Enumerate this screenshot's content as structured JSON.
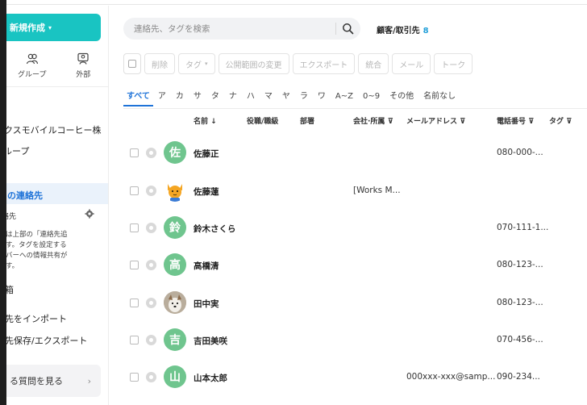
{
  "sidebar": {
    "new_button": "新規作成",
    "tabs": [
      {
        "label": "グループ",
        "icon": "group-icon"
      },
      {
        "label": "外部",
        "icon": "external-icon"
      }
    ],
    "items": {
      "item1": "ークスモバイルコーヒー株",
      "item2": "ループ",
      "all_contacts": "この連絡先",
      "sub_label": "絡先",
      "note": "追加は上部の「連絡先追\nえます。タグを設定する\nメンバーへの情報共有が\nえます。",
      "trash": "箱",
      "import": "先をインポート",
      "export": "先保存/エクスポート",
      "faq": "る質問を見る"
    }
  },
  "search": {
    "placeholder": "連絡先、タグを検索"
  },
  "breadcrumb": {
    "label": "顧客/取引先",
    "count": "8"
  },
  "toolbar": {
    "delete": "削除",
    "tag": "タグ",
    "visibility": "公開範囲の変更",
    "export": "エクスポート",
    "merge": "統合",
    "mail": "メール",
    "talk": "トーク"
  },
  "filters": [
    "すべて",
    "ア",
    "カ",
    "サ",
    "タ",
    "ナ",
    "ハ",
    "マ",
    "ヤ",
    "ラ",
    "ワ",
    "A~Z",
    "0~9",
    "その他",
    "名前なし"
  ],
  "columns": {
    "name": "名前 ↓",
    "title": "役職/職級",
    "dept": "部署",
    "company": "会社·所属",
    "email": "メールアドレス",
    "phone": "電話番号",
    "tag": "タグ"
  },
  "rows": [
    {
      "avatar": "佐",
      "avatar_type": "initial",
      "name": "佐藤正",
      "company": "",
      "email": "",
      "phone": "080-000-..."
    },
    {
      "avatar": "",
      "avatar_type": "cat",
      "name": "佐藤蓮",
      "company": "[Works M...",
      "email": "",
      "phone": ""
    },
    {
      "avatar": "鈴",
      "avatar_type": "initial",
      "name": "鈴木さくら",
      "company": "",
      "email": "",
      "phone": "070-111-1..."
    },
    {
      "avatar": "高",
      "avatar_type": "initial",
      "name": "高橋清",
      "company": "",
      "email": "",
      "phone": "080-123-..."
    },
    {
      "avatar": "",
      "avatar_type": "photo",
      "name": "田中実",
      "company": "",
      "email": "",
      "phone": "080-123-..."
    },
    {
      "avatar": "吉",
      "avatar_type": "initial",
      "name": "吉田美咲",
      "company": "",
      "email": "",
      "phone": "070-456-..."
    },
    {
      "avatar": "山",
      "avatar_type": "initial",
      "name": "山本太郎",
      "company": "",
      "email": "000xxx-xxx@samp...",
      "phone": "090-234..."
    }
  ],
  "colors": {
    "accent": "#19c4c2",
    "active": "#1f73d8",
    "avatar_green": "#6fc58e"
  }
}
